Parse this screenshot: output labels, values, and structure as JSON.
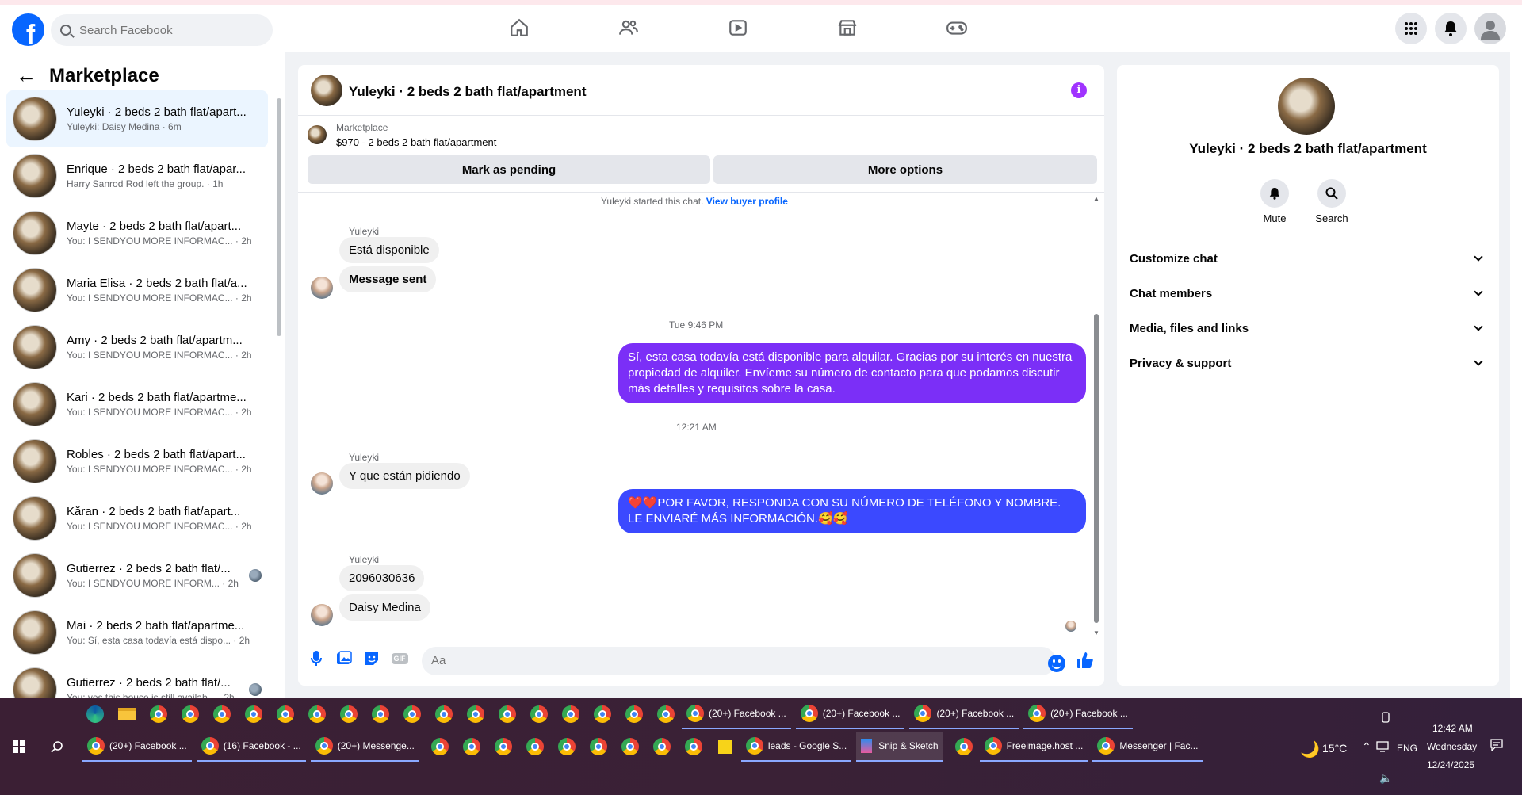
{
  "topbar": {
    "logo_letter": "f",
    "search_placeholder": "Search Facebook",
    "nav_icons": [
      "home-icon",
      "friends-icon",
      "video-icon",
      "marketplace-icon",
      "gaming-icon"
    ],
    "right_icons": [
      "menu-grid-icon",
      "notifications-icon",
      "account-icon"
    ]
  },
  "sidebar": {
    "title": "Marketplace",
    "conversations": [
      {
        "name": "Yuleyki · 2 beds 2 bath flat/apart...",
        "sub": "Yuleyki: Daisy Medina · 6m",
        "active": true
      },
      {
        "name": "Enrique · 2 beds 2 bath flat/apar...",
        "sub": "Harry Sanrod Rod left the group. · 1h"
      },
      {
        "name": "Mayte · 2 beds 2 bath flat/apart...",
        "sub": "You: I SENDYOU MORE INFORMAC... · 2h"
      },
      {
        "name": "Maria Elisa · 2 beds 2 bath flat/a...",
        "sub": "You: I SENDYOU MORE INFORMAC... · 2h"
      },
      {
        "name": "Amy · 2 beds 2 bath flat/apartm...",
        "sub": "You: I SENDYOU MORE INFORMAC... · 2h"
      },
      {
        "name": "Kari · 2 beds 2 bath flat/apartme...",
        "sub": "You: I SENDYOU MORE INFORMAC... · 2h"
      },
      {
        "name": "Robles · 2 beds 2 bath flat/apart...",
        "sub": "You: I SENDYOU MORE INFORMAC... · 2h"
      },
      {
        "name": "Kăran · 2 beds 2 bath flat/apart...",
        "sub": "You: I SENDYOU MORE INFORMAC... · 2h"
      },
      {
        "name": "Gutierrez · 2 beds 2 bath flat/...",
        "sub": "You: I SENDYOU MORE INFORM... · 2h",
        "globe": true
      },
      {
        "name": "Mai · 2 beds 2 bath flat/apartme...",
        "sub": "You: Sí, esta casa todavía está dispo... · 2h"
      },
      {
        "name": "Gutierrez · 2 beds 2 bath flat/...",
        "sub": "You: yes this house is still availab... · 2h",
        "globe": true
      }
    ]
  },
  "chat": {
    "title": "Yuleyki · 2 beds 2 bath flat/apartment",
    "info_glyph": "i",
    "marketplace_label": "Marketplace",
    "listing": "$970 - 2 beds 2 bath flat/apartment",
    "mark_pending": "Mark as pending",
    "more_options": "More options",
    "started_text": "Yuleyki started this chat.",
    "buyer_profile_link": "View buyer profile",
    "sender_name": "Yuleyki",
    "msg_1": "Está disponible",
    "msg_2": "Message sent",
    "time_1": "Tue 9:46 PM",
    "out_1": "Sí, esta casa todavía está disponible para alquilar. Gracias por su interés en nuestra propiedad de alquiler. Envíeme su número de contacto para que podamos discutir más detalles y requisitos sobre la casa.",
    "time_2": "12:21 AM",
    "msg_3": "Y que están pidiendo",
    "out_2": "❤️❤️POR FAVOR, RESPONDA CON SU NÚMERO DE TELÉFONO Y NOMBRE. LE ENVIARÉ MÁS INFORMACIÓN.🥰🥰",
    "msg_4": "2096030636",
    "msg_5": "Daisy Medina",
    "composer_placeholder": "Aa",
    "gif_label": "GIF"
  },
  "details": {
    "title": "Yuleyki · 2 beds 2 bath flat/apartment",
    "mute": "Mute",
    "search": "Search",
    "sections": [
      "Customize chat",
      "Chat members",
      "Media, files and links",
      "Privacy & support"
    ]
  },
  "taskbar": {
    "row1_tabs": [
      "(20+) Facebook ...",
      "(20+) Facebook ...",
      "(20+) Facebook ...",
      "(20+) Facebook ..."
    ],
    "row2_tabs_left": [
      "(20+) Facebook ...",
      "(16) Facebook - ...",
      "(20+) Messenge..."
    ],
    "leads_tab": "leads - Google S...",
    "snip_tab": "Snip & Sketch",
    "freeimage_tab": "Freeimage.host ...",
    "messenger_tab": "Messenger | Fac...",
    "weather": "15°C",
    "lang": "ENG",
    "time": "12:42 AM",
    "day": "Wednesday",
    "date": "12/24/2025"
  }
}
